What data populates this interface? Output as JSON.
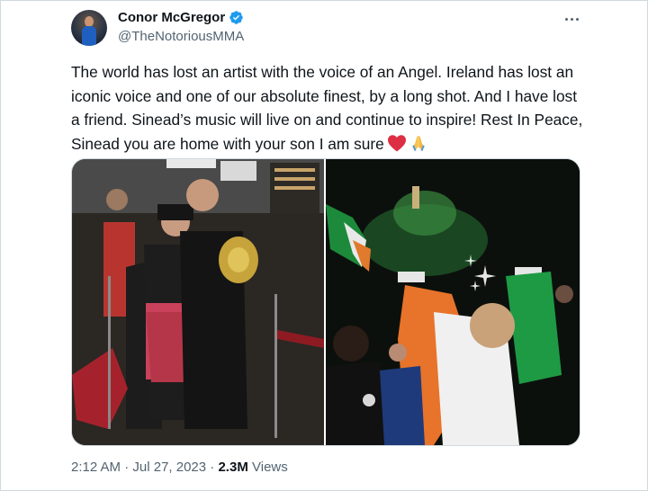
{
  "author": {
    "display_name": "Conor McGregor",
    "handle": "@TheNotoriousMMA",
    "verified": true
  },
  "icons": {
    "verified": "verified-badge-icon",
    "more": "more-options-icon",
    "heart": "red-heart-emoji",
    "pray": "folded-hands-emoji"
  },
  "tweet": {
    "text": "The world has lost an artist with the voice of an Angel. Ireland has lost an iconic voice and one of our absolute finest, by a long shot. And I have lost a friend. Sinead’s music will live on and continue to inspire! Rest In Peace, Sinead you are home with your son I am sure"
  },
  "media": {
    "count": 2
  },
  "meta": {
    "time": "2:12 AM",
    "separator": "·",
    "date": "Jul 27, 2023",
    "views_count": "2.3M",
    "views_label": "Views"
  },
  "colors": {
    "text_primary": "#0f1419",
    "text_secondary": "#536471",
    "verified_blue": "#1d9bf0",
    "border": "#cfd9de"
  }
}
